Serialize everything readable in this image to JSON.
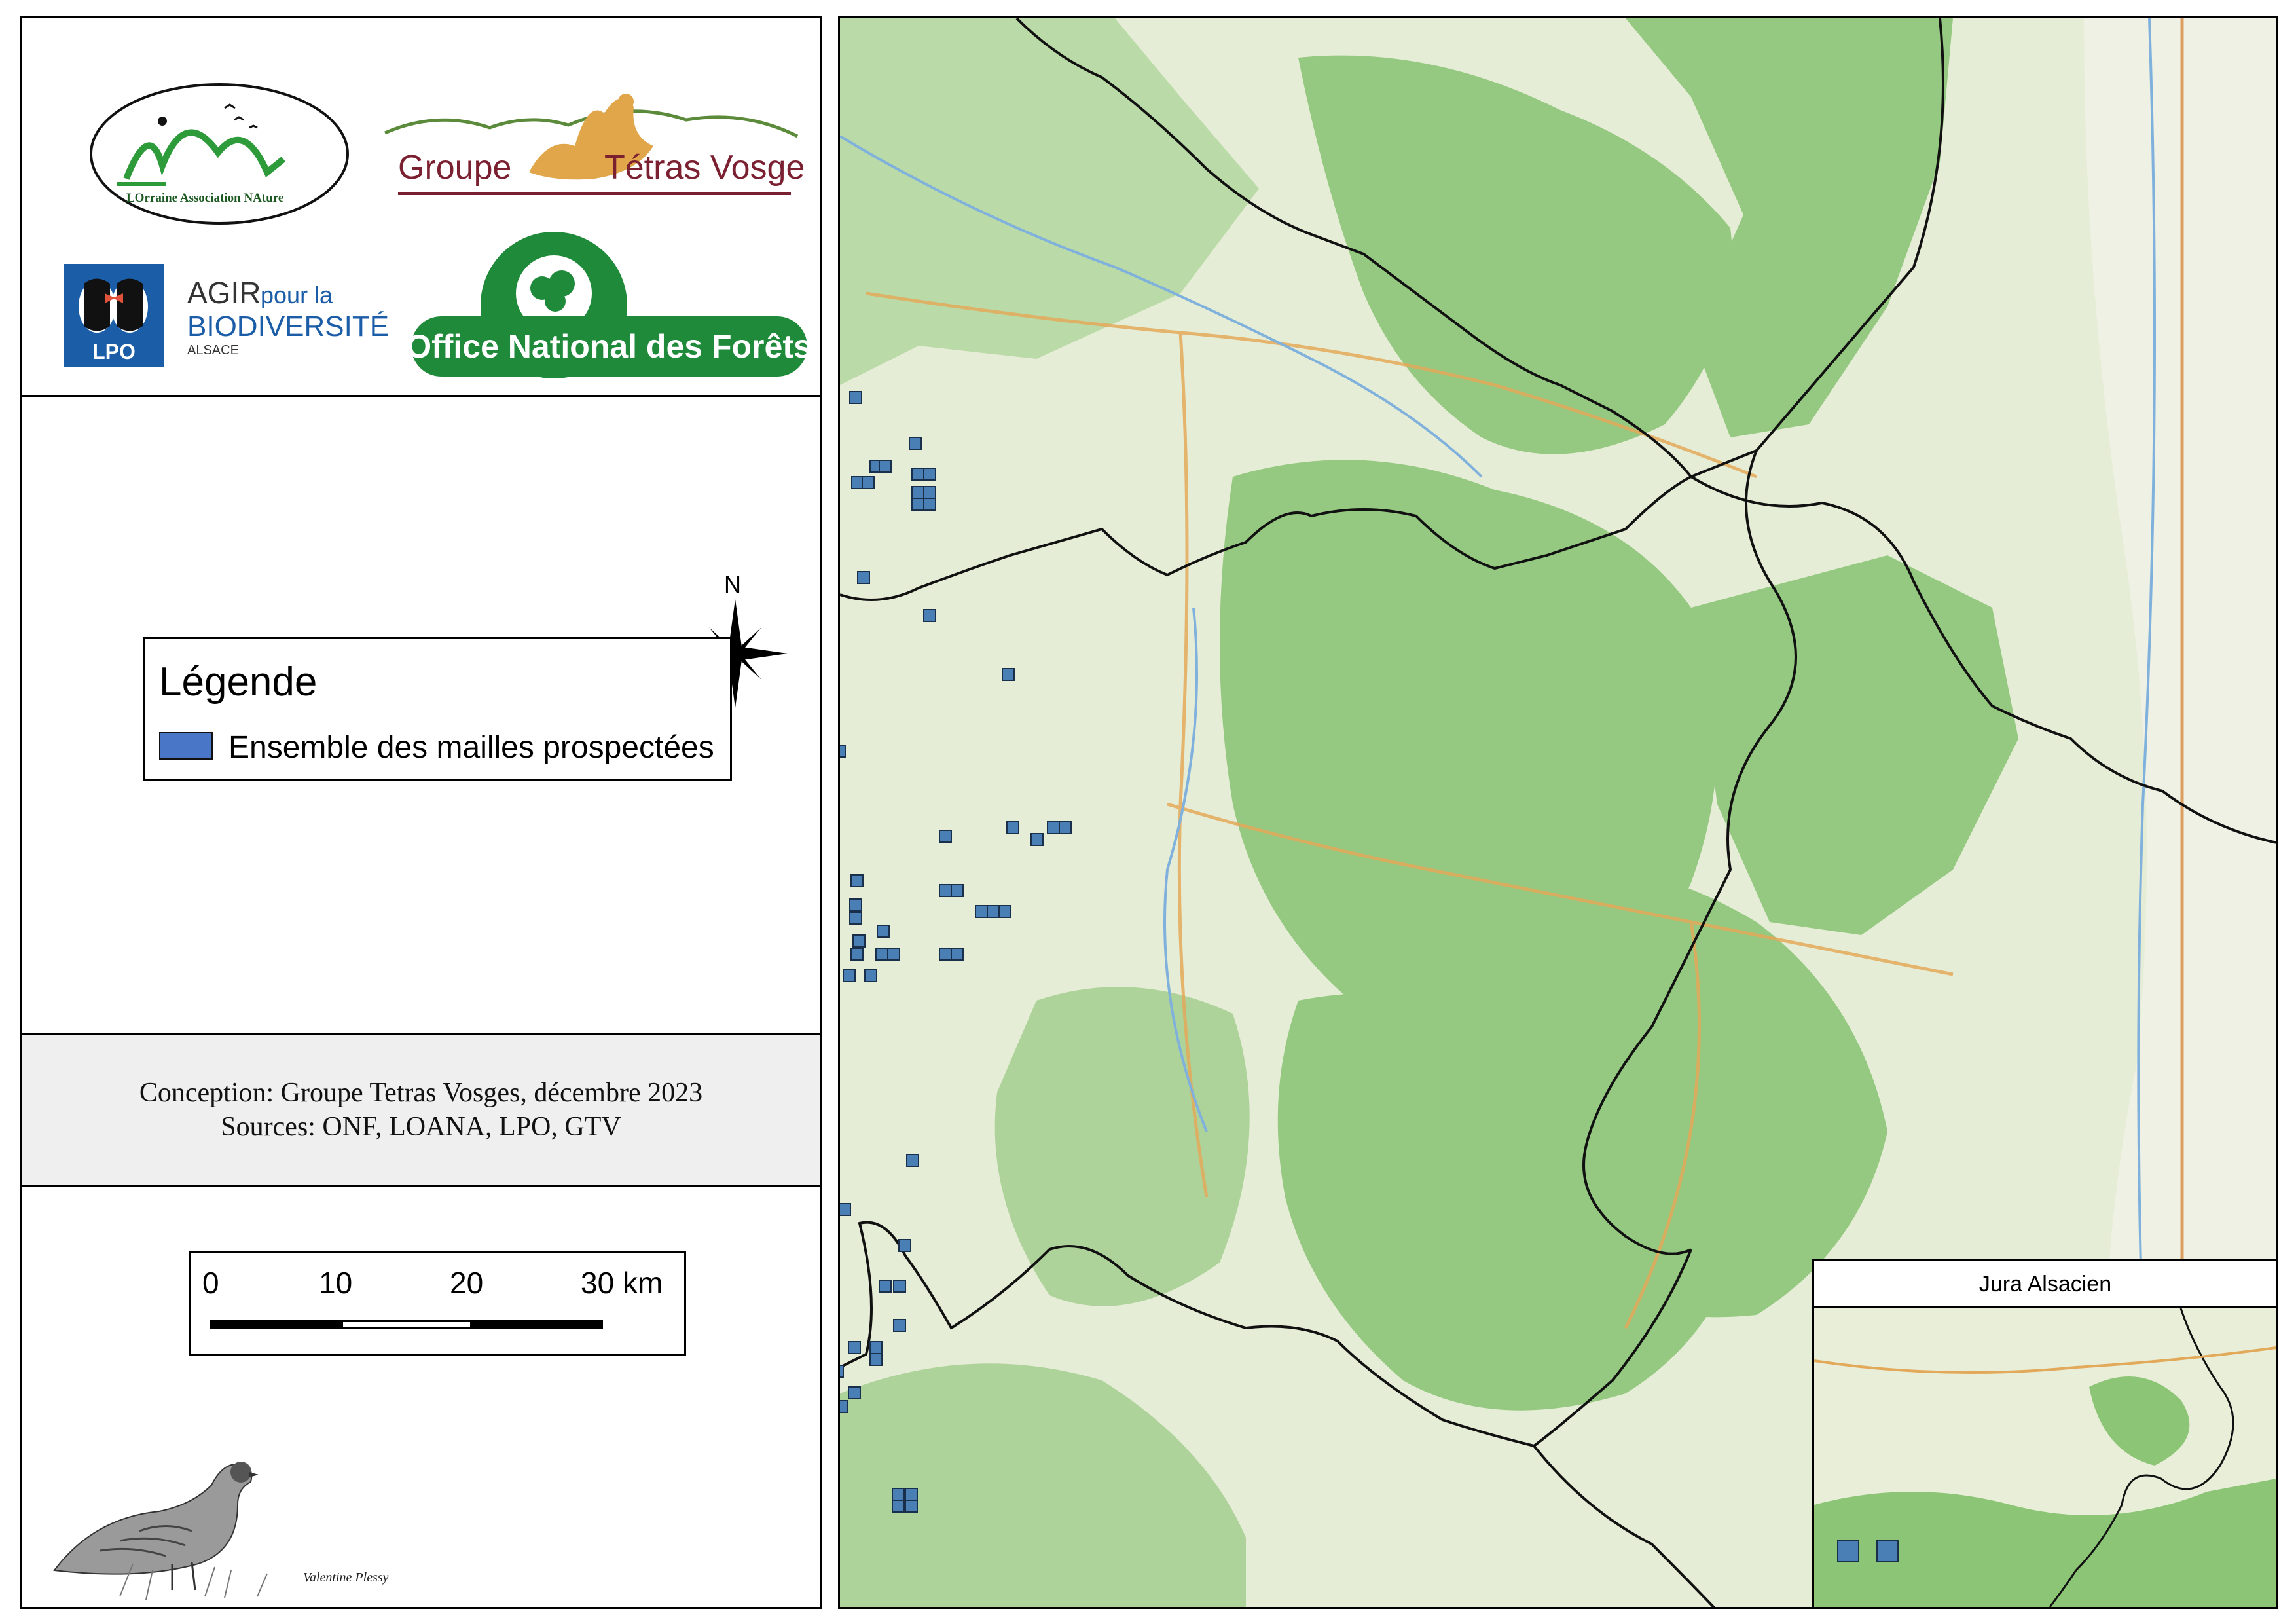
{
  "logos": {
    "loana_text": "LOrraine Association NAture",
    "gtv_text_1": "Groupe",
    "gtv_text_2": "Tétras Vosges",
    "lpo_text_1": "AGIR",
    "lpo_text_2": "pour la",
    "lpo_text_3": "BIODIVERSITÉ",
    "lpo_text_4": "ALSACE",
    "lpo_badge": "LPO",
    "onf_text": "Office National des Forêts"
  },
  "north_arrow": {
    "label": "N"
  },
  "legend": {
    "title": "Légende",
    "item_label": "Ensemble des mailles prospectées",
    "item_color": "#4a76c7"
  },
  "credits": {
    "line1": "Conception: Groupe Tetras Vosges, décembre 2023",
    "line2": "Sources: ONF, LOANA, LPO, GTV"
  },
  "scale": {
    "ticks": [
      "0",
      "10",
      "20",
      "30 km"
    ]
  },
  "signature": "Valentine Plessy",
  "inset": {
    "title": "Jura Alsacien"
  },
  "colors": {
    "cell_fill": "#4a7fb5",
    "forest": "#8fc77a",
    "open_land": "#e8efd8",
    "boundary": "#111111"
  }
}
